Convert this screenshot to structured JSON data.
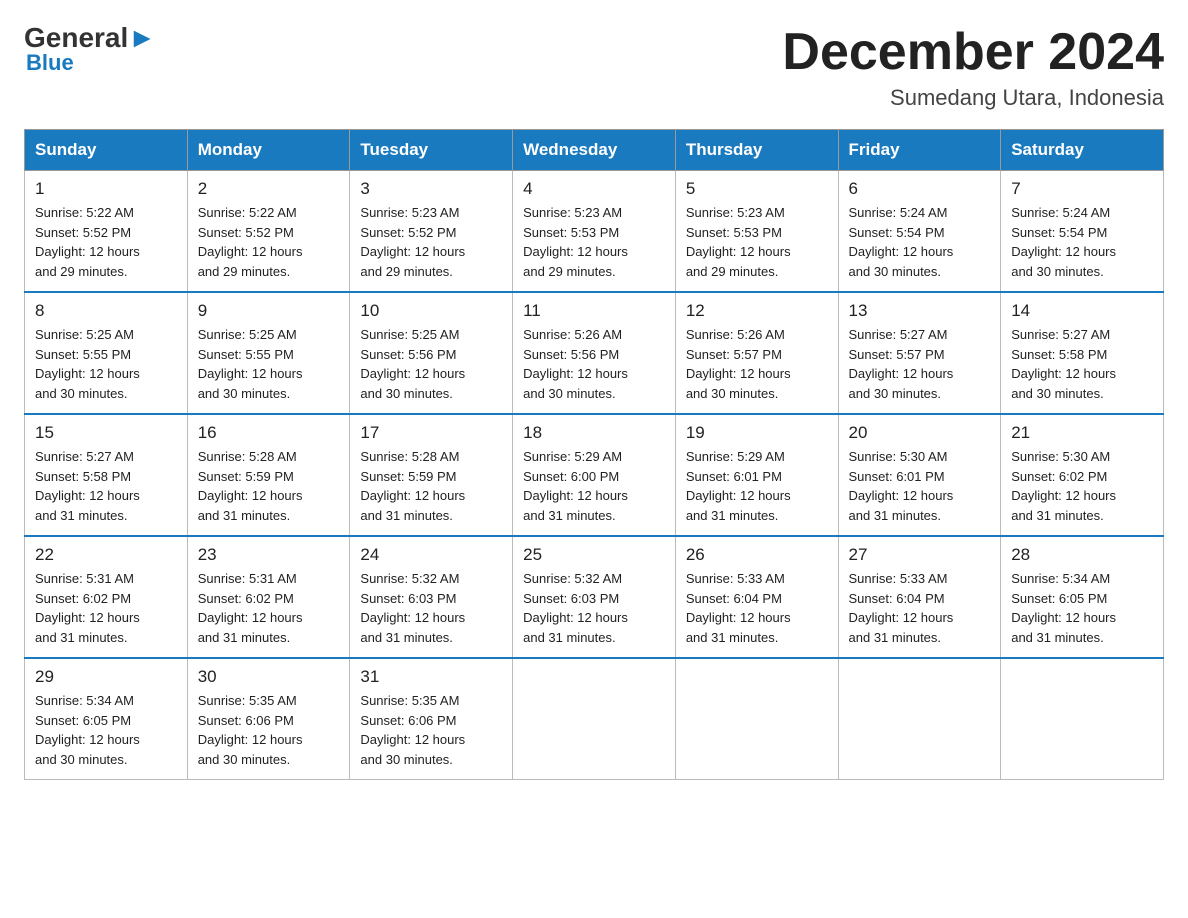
{
  "logo": {
    "general": "General",
    "blue": "Blue",
    "arrow": "▶"
  },
  "title": "December 2024",
  "subtitle": "Sumedang Utara, Indonesia",
  "days_of_week": [
    "Sunday",
    "Monday",
    "Tuesday",
    "Wednesday",
    "Thursday",
    "Friday",
    "Saturday"
  ],
  "weeks": [
    [
      {
        "num": "1",
        "info": "Sunrise: 5:22 AM\nSunset: 5:52 PM\nDaylight: 12 hours\nand 29 minutes."
      },
      {
        "num": "2",
        "info": "Sunrise: 5:22 AM\nSunset: 5:52 PM\nDaylight: 12 hours\nand 29 minutes."
      },
      {
        "num": "3",
        "info": "Sunrise: 5:23 AM\nSunset: 5:52 PM\nDaylight: 12 hours\nand 29 minutes."
      },
      {
        "num": "4",
        "info": "Sunrise: 5:23 AM\nSunset: 5:53 PM\nDaylight: 12 hours\nand 29 minutes."
      },
      {
        "num": "5",
        "info": "Sunrise: 5:23 AM\nSunset: 5:53 PM\nDaylight: 12 hours\nand 29 minutes."
      },
      {
        "num": "6",
        "info": "Sunrise: 5:24 AM\nSunset: 5:54 PM\nDaylight: 12 hours\nand 30 minutes."
      },
      {
        "num": "7",
        "info": "Sunrise: 5:24 AM\nSunset: 5:54 PM\nDaylight: 12 hours\nand 30 minutes."
      }
    ],
    [
      {
        "num": "8",
        "info": "Sunrise: 5:25 AM\nSunset: 5:55 PM\nDaylight: 12 hours\nand 30 minutes."
      },
      {
        "num": "9",
        "info": "Sunrise: 5:25 AM\nSunset: 5:55 PM\nDaylight: 12 hours\nand 30 minutes."
      },
      {
        "num": "10",
        "info": "Sunrise: 5:25 AM\nSunset: 5:56 PM\nDaylight: 12 hours\nand 30 minutes."
      },
      {
        "num": "11",
        "info": "Sunrise: 5:26 AM\nSunset: 5:56 PM\nDaylight: 12 hours\nand 30 minutes."
      },
      {
        "num": "12",
        "info": "Sunrise: 5:26 AM\nSunset: 5:57 PM\nDaylight: 12 hours\nand 30 minutes."
      },
      {
        "num": "13",
        "info": "Sunrise: 5:27 AM\nSunset: 5:57 PM\nDaylight: 12 hours\nand 30 minutes."
      },
      {
        "num": "14",
        "info": "Sunrise: 5:27 AM\nSunset: 5:58 PM\nDaylight: 12 hours\nand 30 minutes."
      }
    ],
    [
      {
        "num": "15",
        "info": "Sunrise: 5:27 AM\nSunset: 5:58 PM\nDaylight: 12 hours\nand 31 minutes."
      },
      {
        "num": "16",
        "info": "Sunrise: 5:28 AM\nSunset: 5:59 PM\nDaylight: 12 hours\nand 31 minutes."
      },
      {
        "num": "17",
        "info": "Sunrise: 5:28 AM\nSunset: 5:59 PM\nDaylight: 12 hours\nand 31 minutes."
      },
      {
        "num": "18",
        "info": "Sunrise: 5:29 AM\nSunset: 6:00 PM\nDaylight: 12 hours\nand 31 minutes."
      },
      {
        "num": "19",
        "info": "Sunrise: 5:29 AM\nSunset: 6:01 PM\nDaylight: 12 hours\nand 31 minutes."
      },
      {
        "num": "20",
        "info": "Sunrise: 5:30 AM\nSunset: 6:01 PM\nDaylight: 12 hours\nand 31 minutes."
      },
      {
        "num": "21",
        "info": "Sunrise: 5:30 AM\nSunset: 6:02 PM\nDaylight: 12 hours\nand 31 minutes."
      }
    ],
    [
      {
        "num": "22",
        "info": "Sunrise: 5:31 AM\nSunset: 6:02 PM\nDaylight: 12 hours\nand 31 minutes."
      },
      {
        "num": "23",
        "info": "Sunrise: 5:31 AM\nSunset: 6:02 PM\nDaylight: 12 hours\nand 31 minutes."
      },
      {
        "num": "24",
        "info": "Sunrise: 5:32 AM\nSunset: 6:03 PM\nDaylight: 12 hours\nand 31 minutes."
      },
      {
        "num": "25",
        "info": "Sunrise: 5:32 AM\nSunset: 6:03 PM\nDaylight: 12 hours\nand 31 minutes."
      },
      {
        "num": "26",
        "info": "Sunrise: 5:33 AM\nSunset: 6:04 PM\nDaylight: 12 hours\nand 31 minutes."
      },
      {
        "num": "27",
        "info": "Sunrise: 5:33 AM\nSunset: 6:04 PM\nDaylight: 12 hours\nand 31 minutes."
      },
      {
        "num": "28",
        "info": "Sunrise: 5:34 AM\nSunset: 6:05 PM\nDaylight: 12 hours\nand 31 minutes."
      }
    ],
    [
      {
        "num": "29",
        "info": "Sunrise: 5:34 AM\nSunset: 6:05 PM\nDaylight: 12 hours\nand 30 minutes."
      },
      {
        "num": "30",
        "info": "Sunrise: 5:35 AM\nSunset: 6:06 PM\nDaylight: 12 hours\nand 30 minutes."
      },
      {
        "num": "31",
        "info": "Sunrise: 5:35 AM\nSunset: 6:06 PM\nDaylight: 12 hours\nand 30 minutes."
      },
      null,
      null,
      null,
      null
    ]
  ]
}
